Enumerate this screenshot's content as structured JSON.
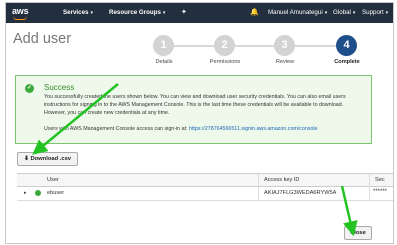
{
  "nav": {
    "logo": "aws",
    "services": "Services",
    "resource_groups": "Resource Groups",
    "user": "Manuel Amunategui",
    "region": "Global",
    "support": "Support"
  },
  "page": {
    "title": "Add user"
  },
  "steps": [
    {
      "number": "1",
      "label": "Details"
    },
    {
      "number": "2",
      "label": "Permissions"
    },
    {
      "number": "3",
      "label": "Review"
    },
    {
      "number": "4",
      "label": "Complete"
    }
  ],
  "success": {
    "title": "Success",
    "body": "You successfully created the users shown below. You can view and download user security credentials. You can also email users instructions for signing in to the AWS Management Console. This is the last time these credentials will be available to download. However, you can create new credentials at any time.",
    "signin_prefix": "Users with AWS Management Console access can sign-in at: ",
    "signin_url": "https://278764566511.signin.aws.amazon.com/console"
  },
  "download_button": "Download .csv",
  "table": {
    "headers": {
      "user": "User",
      "access_key": "Access key ID",
      "secret": "Sec"
    },
    "rows": [
      {
        "user": "ebuser",
        "access_key": "AKIAJ7FLG3WEDA6RYW5A",
        "secret": "******"
      }
    ]
  },
  "close_button": "Close",
  "colors": {
    "nav_bg": "#232f3e",
    "active_step": "#1f4f8b",
    "success_border": "#7cc474",
    "success_bg": "#eef9ec",
    "arrow": "#22c322"
  }
}
